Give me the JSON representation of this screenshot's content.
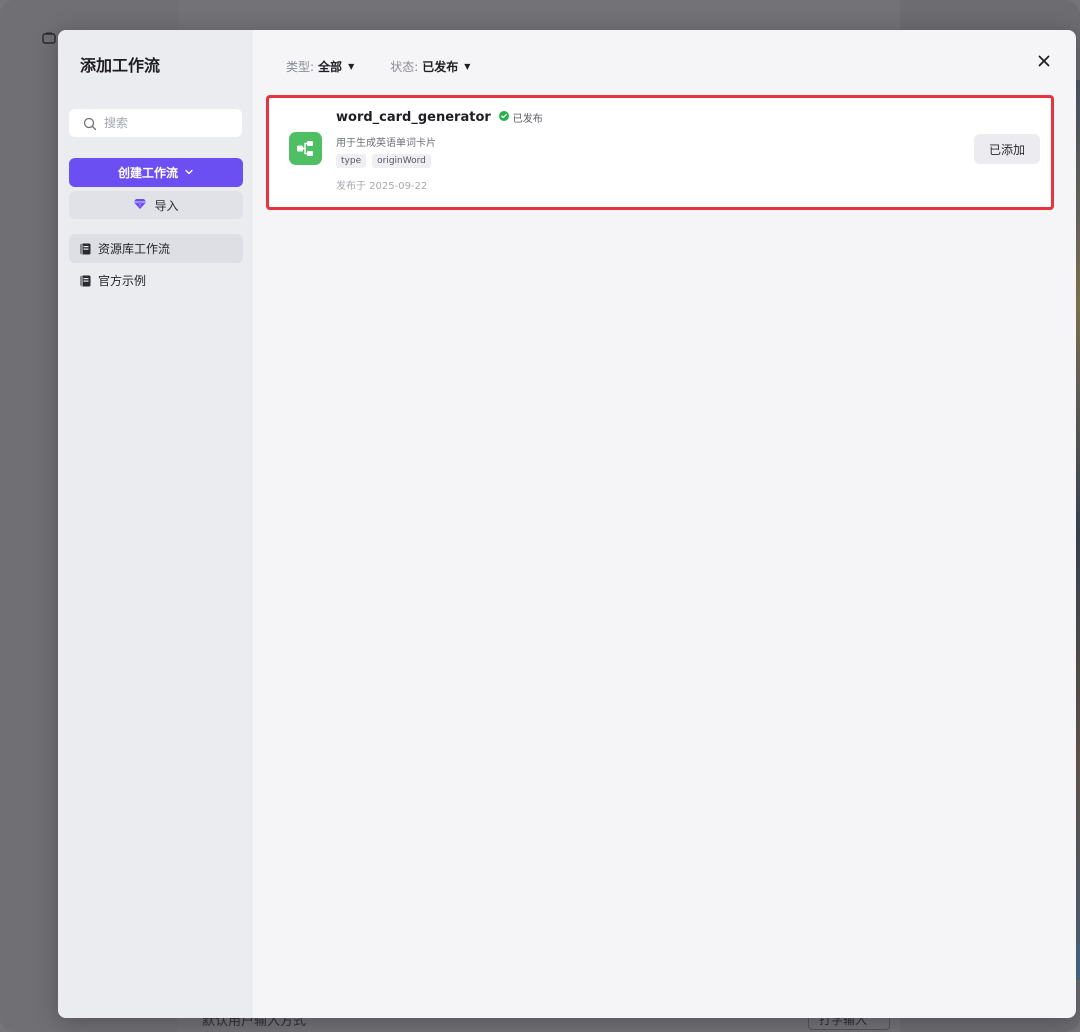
{
  "background": {
    "bottom_text": "默认用户输入方式",
    "bottom_select": "打字输入"
  },
  "modal": {
    "title": "添加工作流",
    "search_placeholder": "搜索",
    "create_button": "创建工作流",
    "import_button": "导入",
    "nav_items": [
      {
        "label": "资源库工作流",
        "active": true
      },
      {
        "label": "官方示例",
        "active": false
      }
    ],
    "filters": {
      "type_label": "类型:",
      "type_value": "全部",
      "status_label": "状态:",
      "status_value": "已发布"
    }
  },
  "workflows": [
    {
      "name": "word_card_generator",
      "status": "已发布",
      "description": "用于生成英语单词卡片",
      "tags": [
        "type",
        "originWord"
      ],
      "date": "发布于 2025-09-22",
      "action": "已添加"
    }
  ],
  "colors": {
    "accent": "#6b4ff2",
    "highlight": "#e8323e",
    "published_green": "#22b14c",
    "workflow_icon_bg": "#4fbf63"
  }
}
